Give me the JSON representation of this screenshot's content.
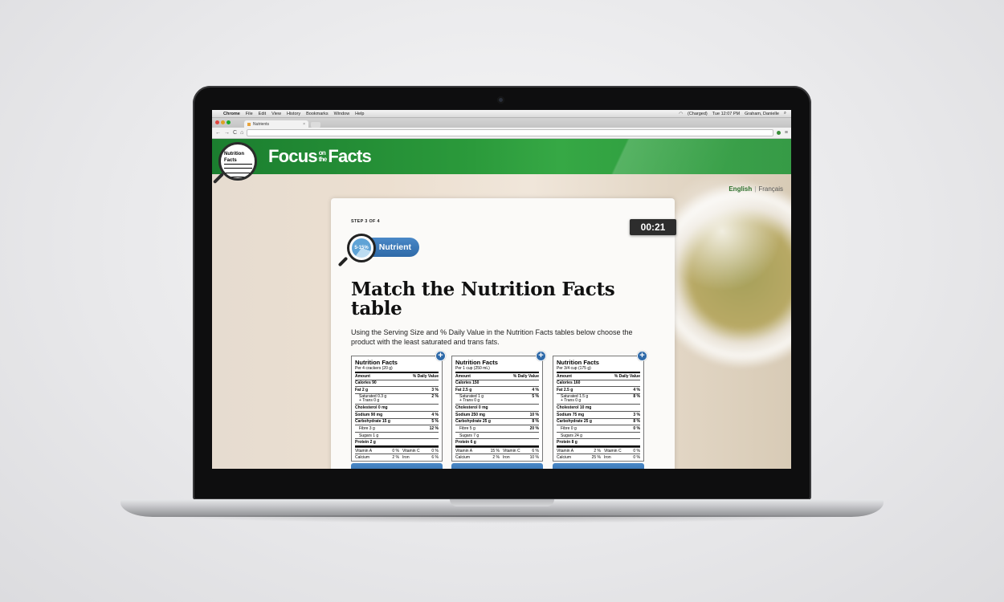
{
  "menubar": {
    "apple": "",
    "items": [
      "Chrome",
      "File",
      "Edit",
      "View",
      "History",
      "Bookmarks",
      "Window",
      "Help"
    ],
    "battery": "(Charged)",
    "clock": "Tue 12:07 PM",
    "user": "Graham, Danielle"
  },
  "browser": {
    "tab_title": "Nutrients",
    "tab_close": "×",
    "back": "←",
    "forward": "→",
    "reload": "C",
    "home": "⌂",
    "address": "",
    "menu": "≡"
  },
  "site": {
    "title_left": "Focus",
    "title_small_top": "on",
    "title_small_bottom": "the",
    "title_right": "Facts",
    "logo_label": "Nutrition Facts",
    "lang_english": "English",
    "lang_sep": "|",
    "lang_french": "Français"
  },
  "card": {
    "step": "STEP 3 OF 4",
    "timer": "00:21",
    "badge_range": "5-15%",
    "badge_label": "Nutrient",
    "heading": "Match the Nutrition Facts table",
    "instructions": "Using the Serving Size and % Daily Value in the Nutrition Facts tables below choose the product with the least saturated and trans fats."
  },
  "panels": [
    {
      "title": "Nutrition Facts",
      "per": "Per 4 crackers (20 g)",
      "amount": "Amount",
      "dv": "% Daily Value",
      "calories": "Calories 90",
      "fat": "Fat 2 g",
      "fat_dv": "3 %",
      "sat": "Saturated 0.3 g",
      "trans": "+ Trans 0 g",
      "sat_dv": "2 %",
      "chol": "Cholesterol 0 mg",
      "sodium": "Sodium 90 mg",
      "sodium_dv": "4 %",
      "carb": "Carbohydrate 15 g",
      "carb_dv": "5 %",
      "fibre": "Fibre 3 g",
      "fibre_dv": "12 %",
      "sugars": "Sugars 1 g",
      "protein": "Protein 2 g",
      "vita": "Vitamin A",
      "vita_dv": "0 %",
      "vitc": "Vitamin C",
      "vitc_dv": "0 %",
      "calc": "Calcium",
      "calc_dv": "2 %",
      "iron": "Iron",
      "iron_dv": "6 %"
    },
    {
      "title": "Nutrition Facts",
      "per": "Per 1 cup (250 mL)",
      "amount": "Amount",
      "dv": "% Daily Value",
      "calories": "Calories 150",
      "fat": "Fat 2.5 g",
      "fat_dv": "4 %",
      "sat": "Saturated 1 g",
      "trans": "+ Trans 0 g",
      "sat_dv": "5 %",
      "chol": "Cholesterol 0 mg",
      "sodium": "Sodium 250 mg",
      "sodium_dv": "10 %",
      "carb": "Carbohydrate 25 g",
      "carb_dv": "8 %",
      "fibre": "Fibre 5 g",
      "fibre_dv": "20 %",
      "sugars": "Sugars 7 g",
      "protein": "Protein 6 g",
      "vita": "Vitamin A",
      "vita_dv": "15 %",
      "vitc": "Vitamin C",
      "vitc_dv": "6 %",
      "calc": "Calcium",
      "calc_dv": "2 %",
      "iron": "Iron",
      "iron_dv": "10 %"
    },
    {
      "title": "Nutrition Facts",
      "per": "Per 3/4 cup (175 g)",
      "amount": "Amount",
      "dv": "% Daily Value",
      "calories": "Calories 160",
      "fat": "Fat 2.5 g",
      "fat_dv": "4 %",
      "sat": "Saturated 1.5 g",
      "trans": "+ Trans 0 g",
      "sat_dv": "8 %",
      "chol": "Cholesterol 10 mg",
      "sodium": "Sodium 75 mg",
      "sodium_dv": "3 %",
      "carb": "Carbohydrate 25 g",
      "carb_dv": "8 %",
      "fibre": "Fibre 0 g",
      "fibre_dv": "0 %",
      "sugars": "Sugars 24 g",
      "protein": "Protein 8 g",
      "vita": "Vitamin A",
      "vita_dv": "2 %",
      "vitc": "Vitamin C",
      "vitc_dv": "0 %",
      "calc": "Calcium",
      "calc_dv": "25 %",
      "iron": "Iron",
      "iron_dv": "0 %"
    }
  ],
  "icons": {
    "plus": "+"
  },
  "colors": {
    "header_green": "#2b9a3b",
    "accent_blue": "#2f6aa8",
    "timer_bg": "#2d2d2d"
  }
}
